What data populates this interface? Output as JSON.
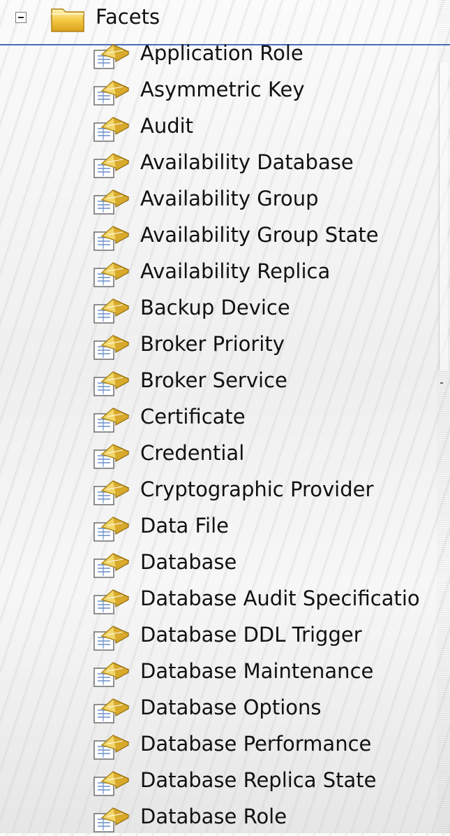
{
  "tree": {
    "root": {
      "label": "Facets",
      "expanded": true,
      "expander_symbol": "−"
    },
    "items": [
      {
        "label": "Application Role"
      },
      {
        "label": "Asymmetric Key"
      },
      {
        "label": "Audit"
      },
      {
        "label": "Availability Database"
      },
      {
        "label": "Availability Group"
      },
      {
        "label": "Availability Group State"
      },
      {
        "label": "Availability Replica"
      },
      {
        "label": "Backup Device"
      },
      {
        "label": "Broker Priority"
      },
      {
        "label": "Broker Service"
      },
      {
        "label": "Certificate"
      },
      {
        "label": "Credential"
      },
      {
        "label": "Cryptographic Provider"
      },
      {
        "label": "Data File"
      },
      {
        "label": "Database"
      },
      {
        "label": "Database Audit Specificatio"
      },
      {
        "label": "Database DDL Trigger"
      },
      {
        "label": "Database Maintenance"
      },
      {
        "label": "Database Options"
      },
      {
        "label": "Database Performance"
      },
      {
        "label": "Database Replica State"
      },
      {
        "label": "Database Role"
      }
    ]
  },
  "colors": {
    "selection_accent": "#4a6bb8",
    "folder_yellow": "#f3c742",
    "icon_gold": "#d8a92a",
    "text": "#111111"
  },
  "icons": {
    "expander": "collapse-minus-icon",
    "folder": "folder-icon",
    "facet": "facet-document-icon"
  }
}
